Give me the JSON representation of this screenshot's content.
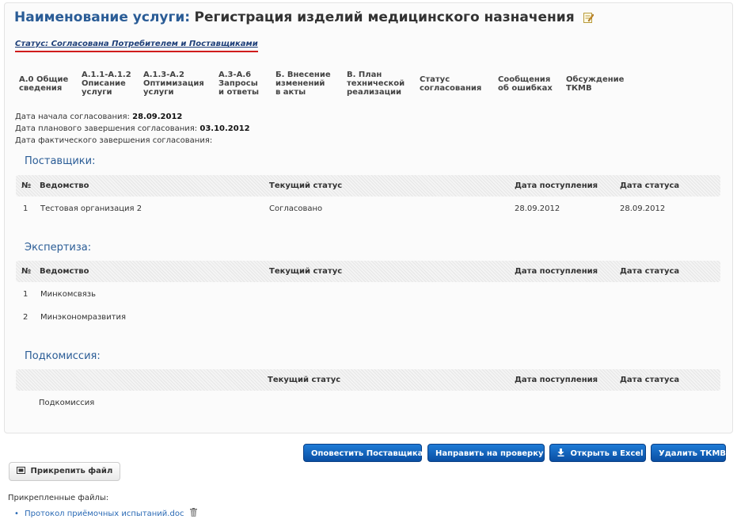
{
  "header": {
    "title_label": "Наименование услуги:",
    "title_value": "Регистрация изделий медицинского назначения",
    "status": "Статус: Согласована Потребителем и Поставщиками"
  },
  "tabs": [
    {
      "line1": "А.0 Общие",
      "line2": "сведения",
      "line3": ""
    },
    {
      "line1": "А.1.1-А.1.2",
      "line2": "Описание",
      "line3": "услуги"
    },
    {
      "line1": "А.1.3-А.2",
      "line2": "Оптимизация",
      "line3": "услуги"
    },
    {
      "line1": "А.3-А.6",
      "line2": "Запросы",
      "line3": "и ответы"
    },
    {
      "line1": "Б. Внесение",
      "line2": "изменений",
      "line3": "в акты"
    },
    {
      "line1": "В. План",
      "line2": "технической",
      "line3": "реализации"
    },
    {
      "line1": "Статус",
      "line2": "согласования",
      "line3": ""
    },
    {
      "line1": "Сообщения",
      "line2": "об ошибках",
      "line3": ""
    },
    {
      "line1": "Обсуждение",
      "line2": "ТКМВ",
      "line3": ""
    }
  ],
  "dates": {
    "start_label": "Дата начала согласования:",
    "start_value": "28.09.2012",
    "planned_label": "Дата планового завершения согласования:",
    "planned_value": "03.10.2012",
    "actual_label": "Дата фактического завершения согласования:"
  },
  "columns": {
    "num": "№",
    "dept": "Ведомство",
    "status": "Текущий статус",
    "received": "Дата поступления",
    "status_date": "Дата статуса"
  },
  "suppliers": {
    "title": "Поставщики:",
    "rows": [
      {
        "num": "1",
        "dept": "Тестовая организация 2",
        "status": "Согласовано",
        "received": "28.09.2012",
        "status_date": "28.09.2012"
      }
    ]
  },
  "expertise": {
    "title": "Экспертиза:",
    "rows": [
      {
        "num": "1",
        "dept": "Минкомсвязь"
      },
      {
        "num": "2",
        "dept": "Минэкономразвития"
      }
    ]
  },
  "subcommission": {
    "title": "Подкомиссия:",
    "row_label": "Подкомиссия"
  },
  "actions": {
    "notify_supplier": "Оповестить Поставщика",
    "send_review": "Направить на проверку",
    "open_excel": "Открыть в Excel",
    "delete_tkmv": "Удалить ТКМВ"
  },
  "attachments": {
    "attach_button": "Прикрепить файл",
    "label": "Прикрепленные файлы:",
    "files": [
      "Протокол приёмочных испытаний.doc"
    ]
  },
  "colors": {
    "accent": "#2a5c96",
    "button": "#0a4fa3",
    "status_underline": "#d01c1c"
  }
}
